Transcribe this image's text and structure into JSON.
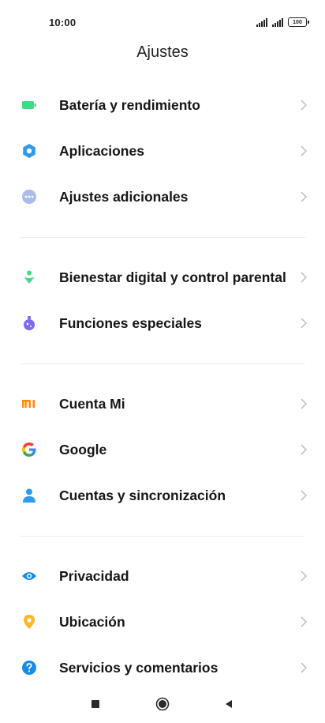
{
  "status_bar": {
    "time": "10:00",
    "battery_level": "100"
  },
  "header": {
    "title": "Ajustes"
  },
  "sections": [
    {
      "items": [
        {
          "label": "Batería y rendimiento",
          "icon": "battery-icon",
          "color": "#3ddc84"
        },
        {
          "label": "Aplicaciones",
          "icon": "gear-icon",
          "color": "#2f9bf0"
        },
        {
          "label": "Ajustes adicionales",
          "icon": "more-dots-icon",
          "color": "#9fb4e6"
        }
      ]
    },
    {
      "items": [
        {
          "label": "Bienestar digital y control parental",
          "icon": "wellbeing-icon",
          "color": "#3ddc84"
        },
        {
          "label": "Funciones especiales",
          "icon": "flask-icon",
          "color": "#7b6cf6"
        }
      ]
    },
    {
      "items": [
        {
          "label": "Cuenta Mi",
          "icon": "mi-logo-icon",
          "color": "#ff8a00"
        },
        {
          "label": "Google",
          "icon": "google-icon",
          "color": "#4285f4"
        },
        {
          "label": "Cuentas y sincronización",
          "icon": "person-icon",
          "color": "#2f9bf0"
        }
      ]
    },
    {
      "items": [
        {
          "label": "Privacidad",
          "icon": "eye-icon",
          "color": "#1a8be6"
        },
        {
          "label": "Ubicación",
          "icon": "location-pin-icon",
          "color": "#ffb82e"
        },
        {
          "label": "Servicios y comentarios",
          "icon": "question-icon",
          "color": "#1a8be6"
        }
      ]
    }
  ],
  "nav_bar": {
    "recents_icon": "square-icon",
    "home_icon": "circle-icon",
    "back_icon": "triangle-back-icon"
  }
}
